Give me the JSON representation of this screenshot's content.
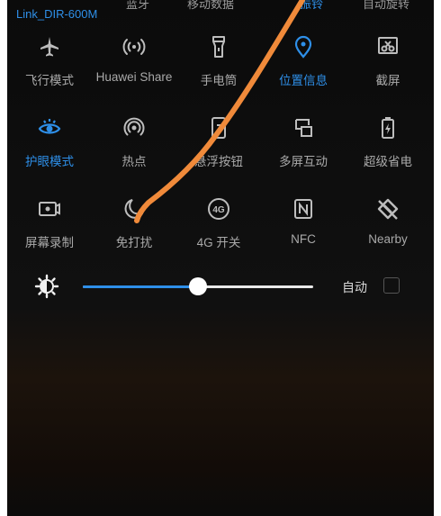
{
  "top_row_cut": [
    "蓝牙",
    "移动数据",
    "振铃",
    "自动旋转"
  ],
  "wifi": {
    "network": "Link_DIR-600M"
  },
  "tiles": [
    [
      {
        "label": "飞行模式",
        "icon": "airplane-icon",
        "active": false
      },
      {
        "label": "Huawei Share",
        "icon": "huawei-share-icon",
        "active": false
      },
      {
        "label": "手电筒",
        "icon": "flashlight-icon",
        "active": false
      },
      {
        "label": "位置信息",
        "icon": "location-pin-icon",
        "active": true
      },
      {
        "label": "截屏",
        "icon": "screenshot-icon",
        "active": false
      }
    ],
    [
      {
        "label": "护眼模式",
        "icon": "eye-icon",
        "active": true
      },
      {
        "label": "热点",
        "icon": "hotspot-icon",
        "active": false
      },
      {
        "label": "悬浮按钮",
        "icon": "floating-button-icon",
        "active": false
      },
      {
        "label": "多屏互动",
        "icon": "multiscreen-icon",
        "active": false
      },
      {
        "label": "超级省电",
        "icon": "battery-saver-icon",
        "active": false
      }
    ],
    [
      {
        "label": "屏幕录制",
        "icon": "screen-record-icon",
        "active": false
      },
      {
        "label": "免打扰",
        "icon": "moon-icon",
        "active": false
      },
      {
        "label": "4G 开关",
        "icon": "4g-icon",
        "active": false
      },
      {
        "label": "NFC",
        "icon": "nfc-icon",
        "active": false
      },
      {
        "label": "Nearby",
        "icon": "nearby-icon",
        "active": false
      }
    ]
  ],
  "brightness": {
    "level": 0.5,
    "auto_label": "自动",
    "auto_checked": false
  },
  "colors": {
    "accent": "#2e8fe8",
    "label": "#a9a9a9",
    "gesture": "#f08a3a"
  }
}
